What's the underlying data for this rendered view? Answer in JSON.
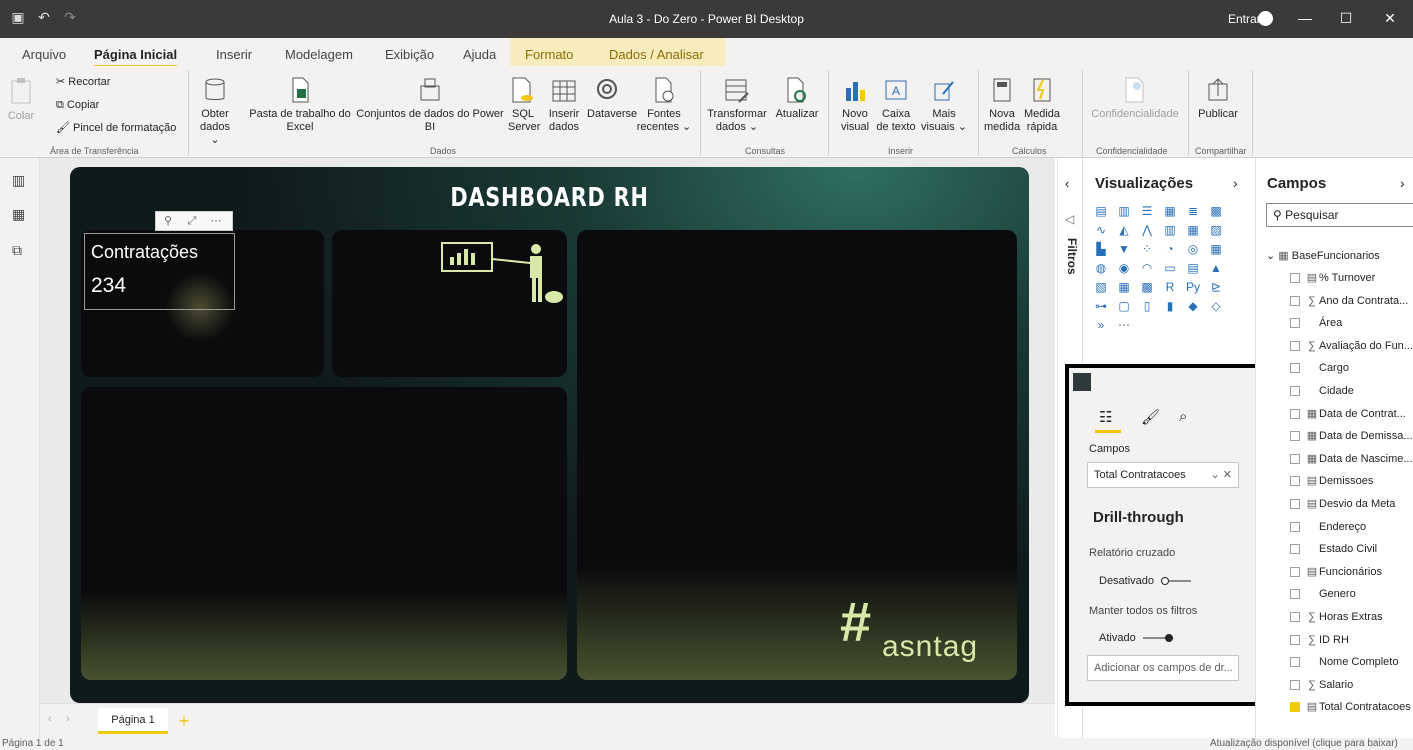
{
  "window": {
    "title": "Aula 3 - Do Zero - Power BI Desktop",
    "signin": "Entrar"
  },
  "tabs": [
    "Arquivo",
    "Página Inicial",
    "Inserir",
    "Modelagem",
    "Exibição",
    "Ajuda",
    "Formato",
    "Dados / Analisar"
  ],
  "ribbon": {
    "colar": "Colar",
    "recortar": "Recortar",
    "copiar": "Copiar",
    "pincel": "Pincel de formatação",
    "obter": "Obter dados ⌄",
    "pasta": "Pasta de trabalho do Excel",
    "conjuntos": "Conjuntos de dados do Power BI",
    "sql": "SQL Server",
    "inserir_dados": "Inserir dados",
    "dataverse": "Dataverse",
    "fontes": "Fontes recentes ⌄",
    "transformar": "Transformar dados ⌄",
    "atualizar": "Atualizar",
    "novo_visual": "Novo visual",
    "caixa_texto": "Caixa de texto",
    "mais_visuais": "Mais visuais ⌄",
    "nova_medida": "Nova medida",
    "medida_rapida": "Medida rápida",
    "confidencialidade": "Confidencialidade",
    "publicar": "Publicar",
    "groups": [
      "Área de Transferência",
      "Dados",
      "Consultas",
      "Inserir",
      "Cálculos",
      "Confidencialidade",
      "Compartilhar"
    ]
  },
  "report": {
    "title": "DASHBOARD RH",
    "card_label": "Contratações",
    "card_value": "234",
    "logo": "asntag"
  },
  "pages": {
    "tab": "Página 1",
    "add": "+"
  },
  "status": {
    "left": "Página 1 de 1",
    "right": "Atualização disponível (clique para baixar)"
  },
  "filters_label": "Filtros",
  "visualizations": {
    "title": "Visualizações",
    "fields_label": "Campos",
    "field_value": "Total Contratacoes",
    "drill_title": "Drill-through",
    "cross_report": "Relatório cruzado",
    "cross_state": "Desativado",
    "keep_filters": "Manter todos os filtros",
    "keep_state": "Ativado",
    "add_fields": "Adicionar os campos de dr..."
  },
  "fields": {
    "title": "Campos",
    "search_placeholder": "Pesquisar",
    "table": "BaseFuncionarios",
    "items": [
      {
        "name": "% Turnover",
        "sym": "▤"
      },
      {
        "name": "Ano da Contrata...",
        "sym": "∑"
      },
      {
        "name": "Área",
        "sym": ""
      },
      {
        "name": "Avaliação do Fun...",
        "sym": "∑"
      },
      {
        "name": "Cargo",
        "sym": ""
      },
      {
        "name": "Cidade",
        "sym": ""
      },
      {
        "name": "Data de Contrat...",
        "sym": "▦"
      },
      {
        "name": "Data de Demissa...",
        "sym": "▦"
      },
      {
        "name": "Data de Nascime...",
        "sym": "▦"
      },
      {
        "name": "Demissoes",
        "sym": "▤"
      },
      {
        "name": "Desvio da Meta",
        "sym": "▤"
      },
      {
        "name": "Endereço",
        "sym": ""
      },
      {
        "name": "Estado Civil",
        "sym": ""
      },
      {
        "name": "Funcionários",
        "sym": "▤"
      },
      {
        "name": "Genero",
        "sym": ""
      },
      {
        "name": "Horas Extras",
        "sym": "∑"
      },
      {
        "name": "ID RH",
        "sym": "∑"
      },
      {
        "name": "Nome Completo",
        "sym": ""
      },
      {
        "name": "Salario",
        "sym": "∑"
      },
      {
        "name": "Total Contratacoes",
        "sym": "▤",
        "checked": true
      }
    ]
  },
  "colors": {
    "accent": "#f2c811",
    "titlebar": "#3b3a39"
  }
}
